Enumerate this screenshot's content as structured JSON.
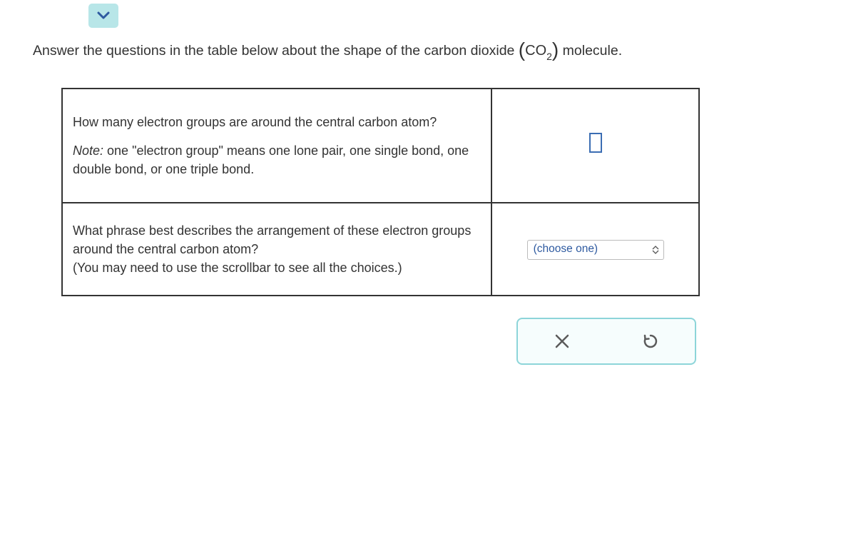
{
  "prompt": {
    "prefix": "Answer the questions in the table below about the shape of the carbon dioxide ",
    "formula_co": "CO",
    "formula_sub": "2",
    "suffix": " molecule."
  },
  "table": {
    "row1": {
      "question_line1": "How many electron groups are around the central carbon atom?",
      "note_label": "Note:",
      "note_text": " one \"electron group\" means one lone pair, one single bond, one double bond, or one triple bond."
    },
    "row2": {
      "question_line1": "What phrase best describes the arrangement of these electron groups around the central carbon atom?",
      "question_line2": "(You may need to use the scrollbar to see all the choices.)",
      "select_placeholder": "(choose one)"
    }
  },
  "icons": {
    "collapse": "chevron-down",
    "close": "close",
    "reset": "undo"
  }
}
